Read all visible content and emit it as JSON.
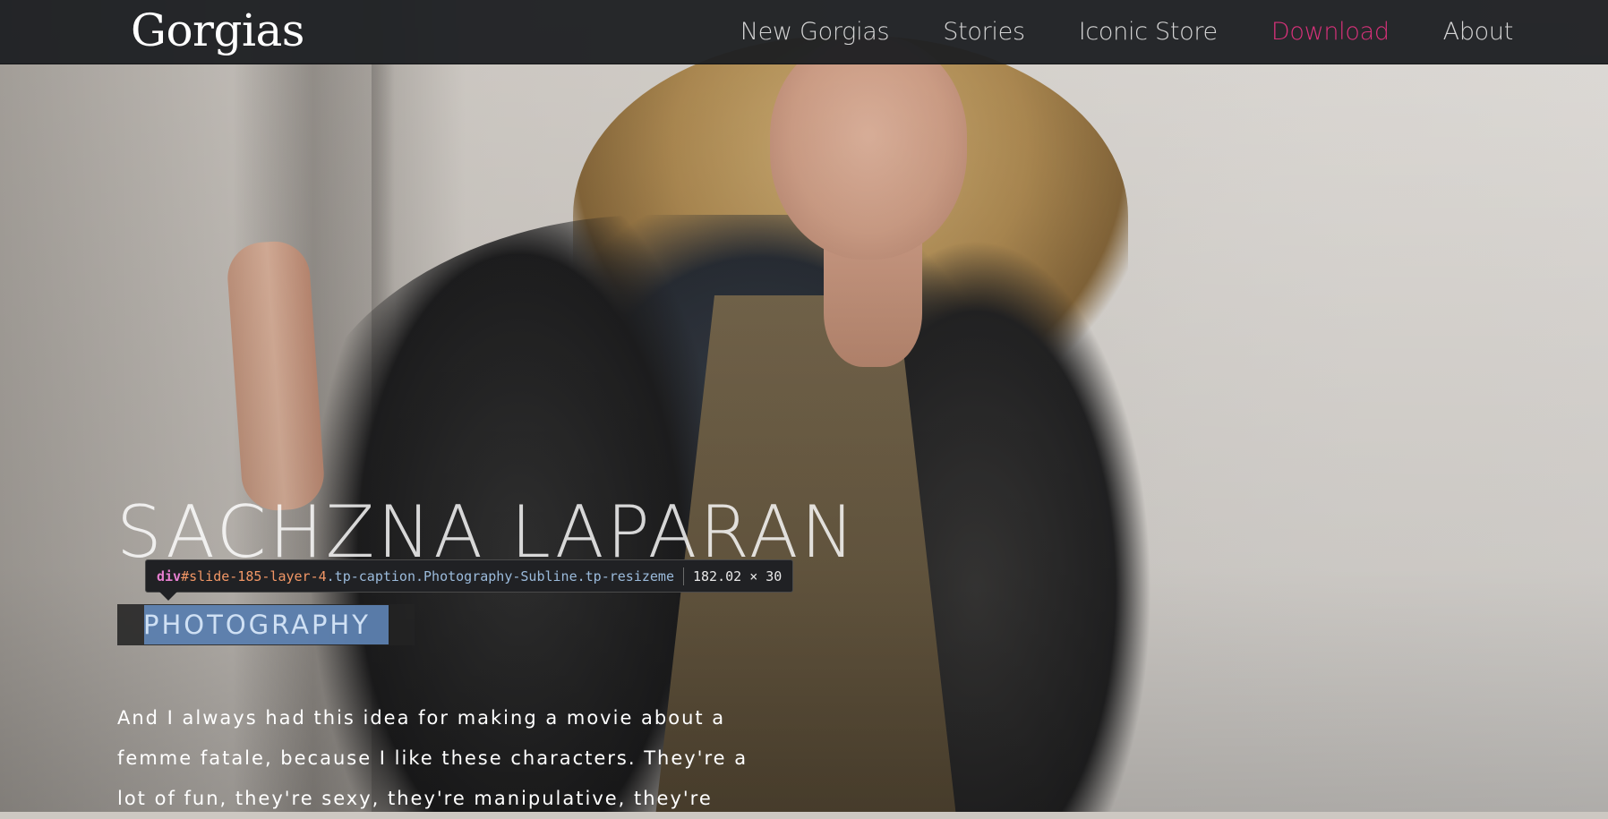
{
  "brand": {
    "name": "Gorgias"
  },
  "nav": {
    "items": [
      {
        "label": "New Gorgias"
      },
      {
        "label": "Stories"
      },
      {
        "label": "Iconic Store"
      },
      {
        "label": "Download"
      },
      {
        "label": "About"
      }
    ],
    "active_color": "#d8317a"
  },
  "hero": {
    "title": "SACHZNA LAPARAN",
    "subline": "PHOTOGRAPHY",
    "body": "And I always had this idea for making a movie about a femme fatale, because I like these characters. They're a lot of fun, they're sexy, they're manipulative, they're"
  },
  "inspector": {
    "tag": "div",
    "hash": "#",
    "id": "slide-185-layer-4",
    "classes": ".tp-caption.Photography-Subline.tp-resizeme",
    "size": "182.02 × 30",
    "highlight_color": "#6f9edc"
  }
}
